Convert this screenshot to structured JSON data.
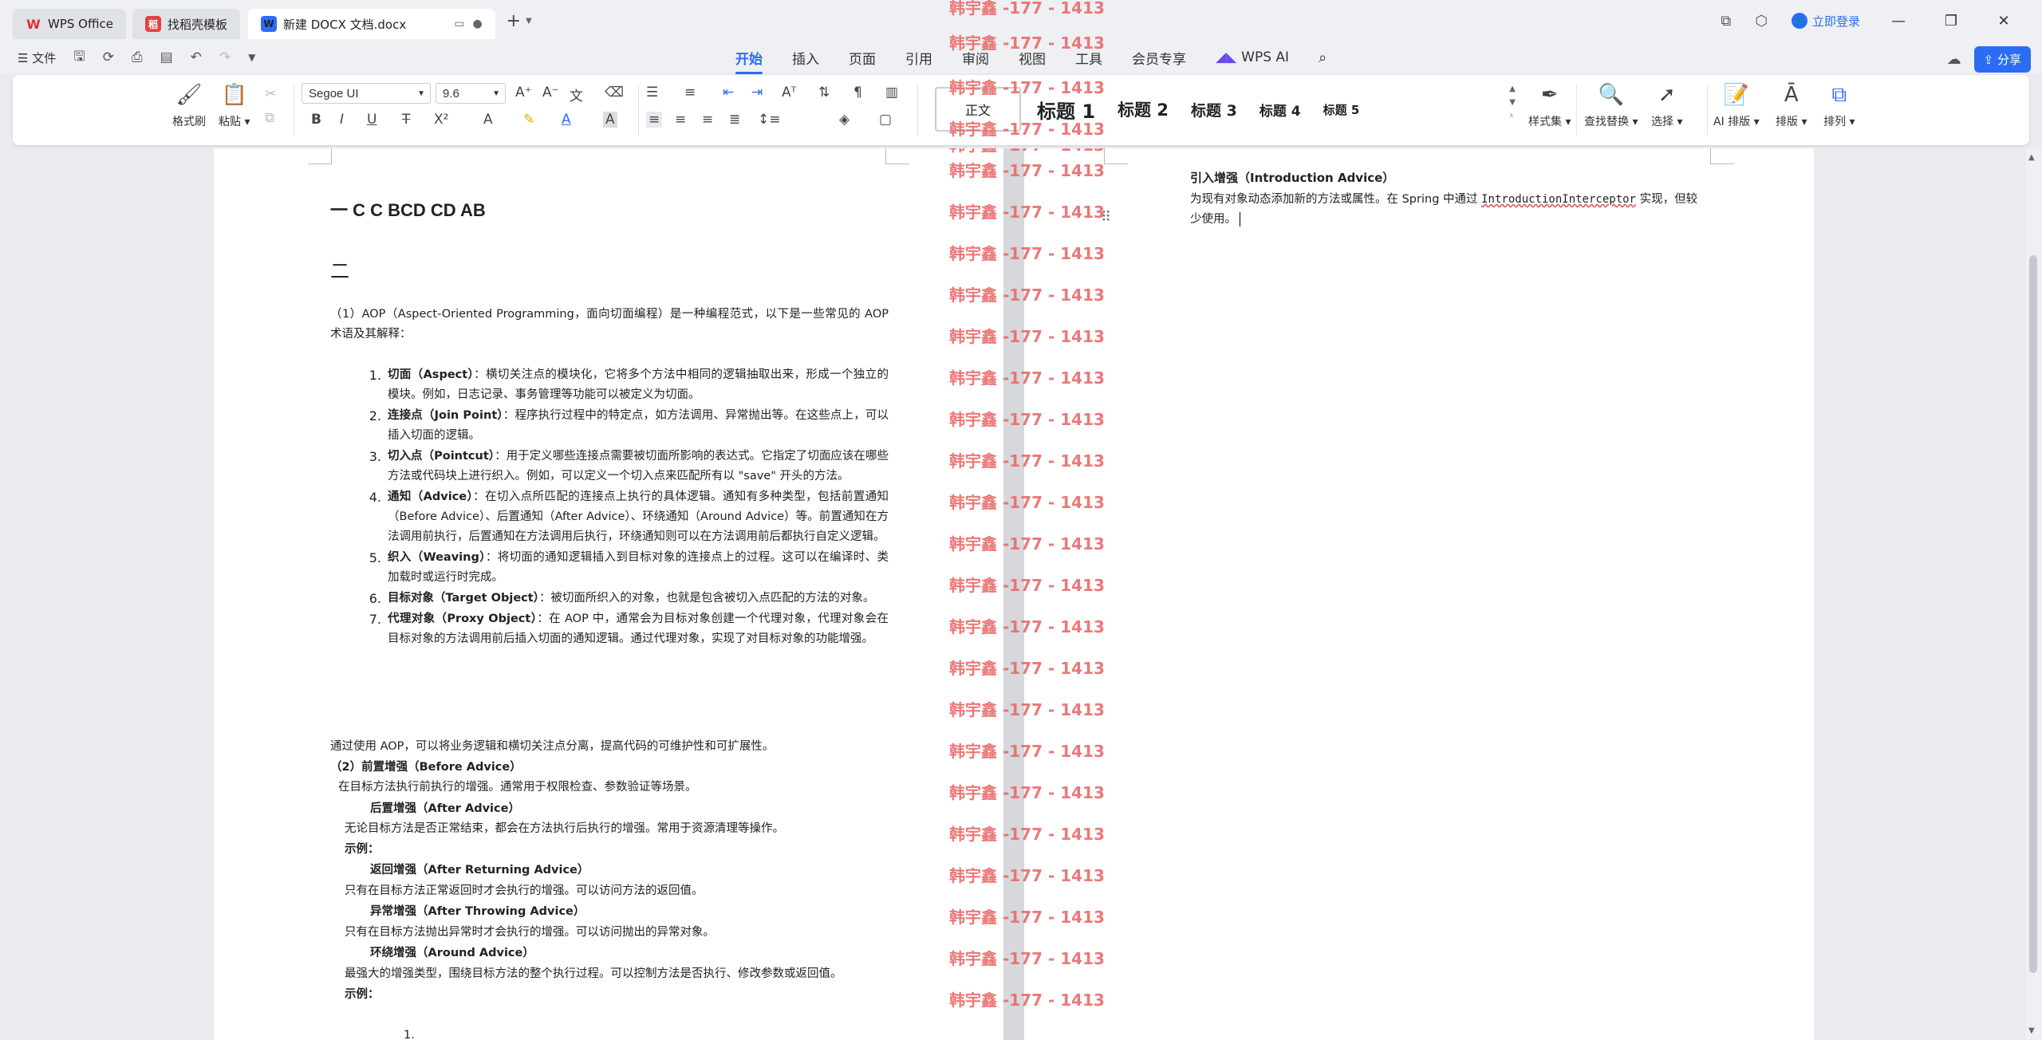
{
  "titlebar": {
    "tabs": [
      {
        "label": "WPS Office",
        "icon": "wps-logo-icon"
      },
      {
        "label": "找稻壳模板",
        "icon": "template-icon"
      },
      {
        "label": "新建 DOCX 文档.docx",
        "icon": "word-doc-icon"
      }
    ],
    "login_label": "立即登录"
  },
  "menubar": {
    "file_label": "文件",
    "tabs": [
      "开始",
      "插入",
      "页面",
      "引用",
      "审阅",
      "视图",
      "工具",
      "会员专享"
    ],
    "active_tab": "开始",
    "wps_ai_label": "WPS AI",
    "share_label": "分享"
  },
  "ribbon": {
    "format_painter_label": "格式刷",
    "paste_label": "粘贴",
    "font_name": "Segoe UI",
    "font_size": "9.6",
    "styles": {
      "normal": "正文",
      "h1": "标题 1",
      "h2": "标题 2",
      "h3": "标题 3",
      "h4": "标题 4",
      "h5": "标题 5"
    },
    "style_set_label": "样式集",
    "find_replace_label": "查找替换",
    "select_label": "选择",
    "ai_layout_label": "AI 排版",
    "layout_label": "排版",
    "arrange_label": "排列"
  },
  "document": {
    "heading1": "一 C C BCD CD AB",
    "heading2": "二",
    "intro": "（1）AOP（Aspect-Oriented Programming，面向切面编程）是一种编程范式，以下是一些常见的 AOP 术语及其解释：",
    "terms": [
      {
        "num": "1.",
        "term": "切面（Aspect）",
        "desc": "：横切关注点的模块化，它将多个方法中相同的逻辑抽取出来，形成一个独立的模块。例如，日志记录、事务管理等功能可以被定义为切面。"
      },
      {
        "num": "2.",
        "term": "连接点（Join Point）",
        "desc": "：程序执行过程中的特定点，如方法调用、异常抛出等。在这些点上，可以插入切面的逻辑。"
      },
      {
        "num": "3.",
        "term": "切入点（Pointcut）",
        "desc": "：用于定义哪些连接点需要被切面所影响的表达式。它指定了切面应该在哪些方法或代码块上进行织入。例如，可以定义一个切入点来匹配所有以 \"save\" 开头的方法。"
      },
      {
        "num": "4.",
        "term": "通知（Advice）",
        "desc": "：在切入点所匹配的连接点上执行的具体逻辑。通知有多种类型，包括前置通知（Before Advice）、后置通知（After Advice）、环绕通知（Around Advice）等。前置通知在方法调用前执行，后置通知在方法调用后执行，环绕通知则可以在方法调用前后都执行自定义逻辑。"
      },
      {
        "num": "5.",
        "term": "织入（Weaving）",
        "desc": "：将切面的通知逻辑插入到目标对象的连接点上的过程。这可以在编译时、类加载时或运行时完成。"
      },
      {
        "num": "6.",
        "term": "目标对象（Target Object）",
        "desc": "：被切面所织入的对象，也就是包含被切入点匹配的方法的对象。"
      },
      {
        "num": "7.",
        "term": "代理对象（Proxy Object）",
        "desc": "：在 AOP 中，通常会为目标对象创建一个代理对象，代理对象会在目标对象的方法调用前后插入切面的通知逻辑。通过代理对象，实现了对目标对象的功能增强。"
      }
    ],
    "summary": "通过使用 AOP，可以将业务逻辑和横切关注点分离，提高代码的可维护性和可扩展性。",
    "before_title": "（2）前置增强（Before Advice）",
    "before_desc": "在目标方法执行前执行的增强。通常用于权限检查、参数验证等场景。",
    "after_title": "后置增强（After Advice）",
    "after_desc": "无论目标方法是否正常结束，都会在方法执行后执行的增强。常用于资源清理等操作。",
    "example1": "示例：",
    "returning_title": "返回增强（After Returning Advice）",
    "returning_desc": "只有在目标方法正常返回时才会执行的增强。可以访问方法的返回值。",
    "throwing_title": "异常增强（After Throwing Advice）",
    "throwing_desc": "只有在目标方法抛出异常时才会执行的增强。可以访问抛出的异常对象。",
    "around_title": "环绕增强（Around Advice）",
    "around_desc": "最强大的增强类型，围绕目标方法的整个执行过程。可以控制方法是否执行、修改参数或返回值。",
    "example2": "示例：",
    "list_start": "1.",
    "right_title": "引入增强（Introduction Advice）",
    "right_text_before": "为现有对象动态添加新的方法或属性。在 Spring 中通过 ",
    "right_code": "IntroductionInterceptor",
    "right_text_after": " 实现，但较少使用。"
  },
  "watermark_text": "韩宇鑫 -177 - 1413",
  "watermark_color": "#ea6a6a",
  "accent_color": "#2b6cf3"
}
